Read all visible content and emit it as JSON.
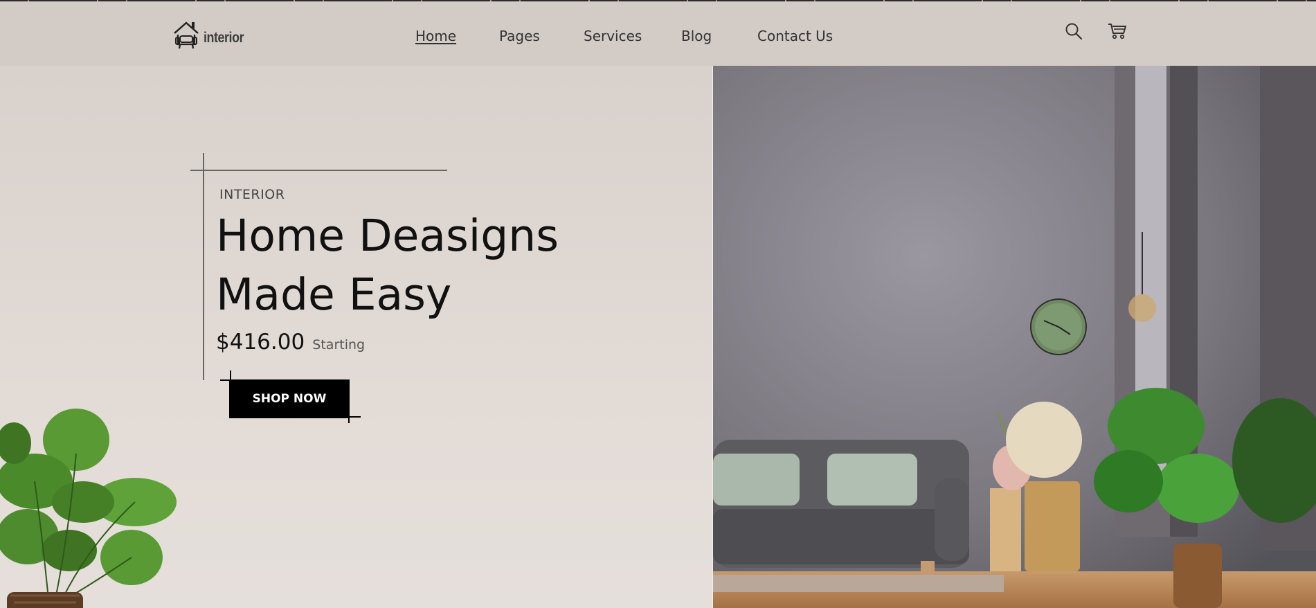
{
  "header": {
    "logo_text": "interior",
    "nav": [
      {
        "label": "Home",
        "active": true
      },
      {
        "label": "Pages",
        "active": false
      },
      {
        "label": "Services",
        "active": false
      },
      {
        "label": "Blog",
        "active": false
      },
      {
        "label": "Contact Us",
        "active": false
      }
    ],
    "icons": [
      "search-icon",
      "cart-icon"
    ]
  },
  "hero": {
    "kicker": "INTERIOR",
    "headline_line1": "Home Deasigns",
    "headline_line2": "Made Easy",
    "price": "$416.00",
    "price_note": "Starting",
    "cta_label": "SHOP NOW"
  },
  "colors": {
    "background": "#d7d0cb",
    "header": "#d2cbc6",
    "text": "#111111",
    "button": "#000000",
    "button_text": "#ffffff"
  }
}
